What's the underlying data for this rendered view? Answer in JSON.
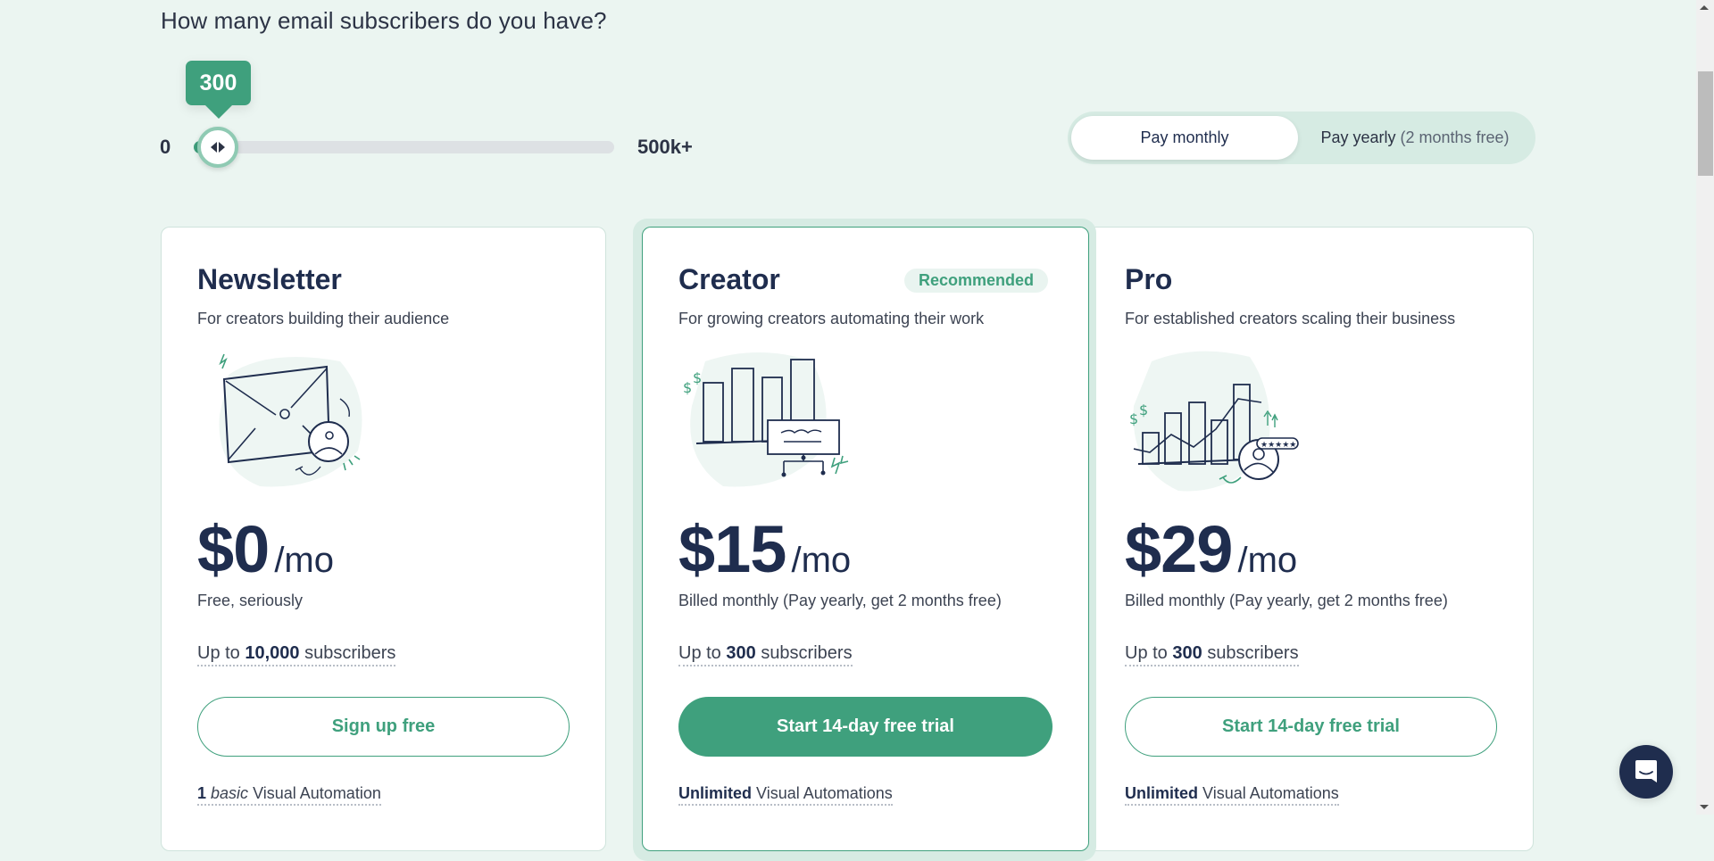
{
  "question": "How many email subscribers do you have?",
  "slider": {
    "min_label": "0",
    "max_label": "500k+",
    "value_label": "300",
    "value": 300,
    "fill_fraction": 0.0
  },
  "billing_toggle": {
    "monthly_label": "Pay monthly",
    "yearly_label": "Pay yearly",
    "yearly_note": "(2 months free)",
    "selected": "monthly"
  },
  "plans": [
    {
      "name": "Newsletter",
      "tagline": "For creators building their audience",
      "price": "$0",
      "unit": "/mo",
      "note": "Free, seriously",
      "subs_prefix": "Up to",
      "subs_count": "10,000",
      "subs_suffix": "subscribers",
      "cta": "Sign up free",
      "feature_bold": "1",
      "feature_italic": "basic",
      "feature_rest": "Visual Automation"
    },
    {
      "name": "Creator",
      "badge": "Recommended",
      "tagline": "For growing creators automating their work",
      "price": "$15",
      "unit": "/mo",
      "note": "Billed monthly (Pay yearly, get 2 months free)",
      "subs_prefix": "Up to",
      "subs_count": "300",
      "subs_suffix": "subscribers",
      "cta": "Start 14-day free trial",
      "feature_bold": "Unlimited",
      "feature_rest": "Visual Automations"
    },
    {
      "name": "Pro",
      "tagline": "For established creators scaling their business",
      "price": "$29",
      "unit": "/mo",
      "note": "Billed monthly (Pay yearly, get 2 months free)",
      "subs_prefix": "Up to",
      "subs_count": "300",
      "subs_suffix": "subscribers",
      "cta": "Start 14-day free trial",
      "feature_bold": "Unlimited",
      "feature_rest": "Visual Automations"
    }
  ],
  "icons": {
    "newsletter_illustration": "envelope-with-user-illustration",
    "creator_illustration": "bar-chart-with-board-illustration",
    "pro_illustration": "growth-chart-with-rating-illustration",
    "chat": "chat-bubble-icon"
  },
  "colors": {
    "accent": "#3fa07d",
    "navy": "#1f2d4e",
    "page_bg": "#ebf5f1",
    "toggle_bg": "#d6ebe3"
  }
}
